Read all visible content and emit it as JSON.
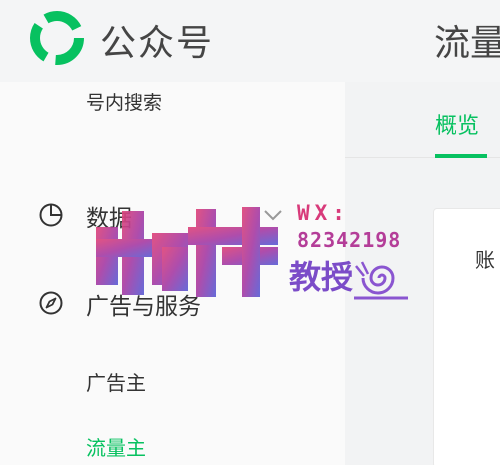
{
  "header": {
    "app_name": "公众号",
    "page_title": "流量"
  },
  "sidebar": {
    "search_label": "号内搜索",
    "groups": [
      {
        "label": "数据",
        "icon": "pie-chart-icon",
        "expanded": false
      },
      {
        "label": "广告与服务",
        "icon": "compass-icon",
        "expanded": true,
        "items": [
          {
            "label": "广告主",
            "active": false
          },
          {
            "label": "流量主",
            "active": true
          }
        ]
      }
    ]
  },
  "main": {
    "tabs": [
      {
        "label": "概览",
        "active": true
      }
    ],
    "card_text": "账"
  },
  "watermark": {
    "wx_label": "WX:",
    "number": "82342198",
    "text": "教授"
  },
  "colors": {
    "accent": "#07c160",
    "watermark_pink": "#d83a7a",
    "watermark_purple": "#7b4cc8"
  }
}
